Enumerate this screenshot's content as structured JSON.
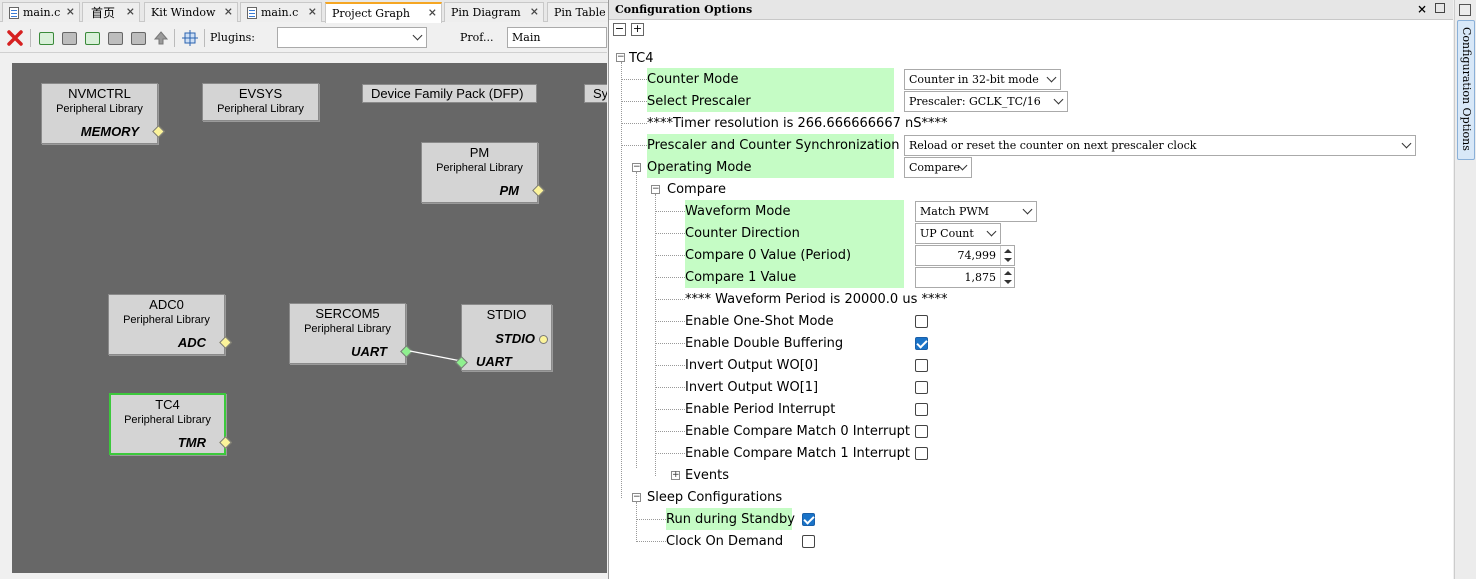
{
  "tabs": [
    {
      "label": "main.c",
      "icon": "c-file-icon",
      "active": false
    },
    {
      "label": "首页",
      "icon": "",
      "active": false
    },
    {
      "label": "Kit Window",
      "icon": "",
      "active": false
    },
    {
      "label": "main.c",
      "icon": "c-file-icon",
      "active": false
    },
    {
      "label": "Project Graph",
      "icon": "",
      "active": true
    },
    {
      "label": "Pin Diagram",
      "icon": "",
      "active": false
    },
    {
      "label": "Pin Table",
      "icon": "",
      "active": false
    }
  ],
  "toolbar": {
    "plugins_label": "Plugins:",
    "plugins_value": "",
    "prof_label": "Prof...",
    "prof_value": "Main"
  },
  "graph": {
    "nvmctrl": {
      "title": "NVMCTRL",
      "sub": "Peripheral Library",
      "port": "MEMORY"
    },
    "evsys": {
      "title": "EVSYS",
      "sub": "Peripheral Library"
    },
    "dfp": {
      "title": "Device Family Pack (DFP)"
    },
    "sy": {
      "title": "Sy"
    },
    "pm": {
      "title": "PM",
      "sub": "Peripheral Library",
      "port": "PM"
    },
    "adc0": {
      "title": "ADC0",
      "sub": "Peripheral Library",
      "port": "ADC"
    },
    "sercom5": {
      "title": "SERCOM5",
      "sub": "Peripheral Library",
      "port": "UART"
    },
    "stdio": {
      "title": "STDIO",
      "port_top": "STDIO",
      "port_bottom": "UART"
    },
    "tc4": {
      "title": "TC4",
      "sub": "Peripheral Library",
      "port": "TMR"
    }
  },
  "config": {
    "title": "Configuration Options",
    "side_tab": "Configuration Options",
    "root": "TC4",
    "counter_mode": {
      "label": "Counter Mode",
      "value": "Counter in 32-bit mode"
    },
    "prescaler": {
      "label": "Select Prescaler",
      "value": "Prescaler: GCLK_TC/16"
    },
    "timer_res": "****Timer resolution is 266.666666667 nS****",
    "presync": {
      "label": "Prescaler and Counter Synchronization",
      "value": "Reload or reset the counter on next prescaler clock"
    },
    "op_mode": {
      "label": "Operating Mode",
      "value": "Compare"
    },
    "compare": "Compare",
    "waveform_mode": {
      "label": "Waveform Mode",
      "value": "Match PWM"
    },
    "counter_dir": {
      "label": "Counter Direction",
      "value": "UP Count"
    },
    "cmp0": {
      "label": "Compare 0 Value (Period)",
      "value": "74,999"
    },
    "cmp1": {
      "label": "Compare 1 Value",
      "value": "1,875"
    },
    "wave_period": "**** Waveform Period is 20000.0 us ****",
    "one_shot": {
      "label": "Enable One-Shot Mode",
      "checked": false
    },
    "double_buf": {
      "label": "Enable Double Buffering",
      "checked": true
    },
    "inv_wo0": {
      "label": "Invert Output WO[0]",
      "checked": false
    },
    "inv_wo1": {
      "label": "Invert Output WO[1]",
      "checked": false
    },
    "period_int": {
      "label": "Enable Period Interrupt",
      "checked": false
    },
    "cm0_int": {
      "label": "Enable Compare Match 0 Interrupt",
      "checked": false
    },
    "cm1_int": {
      "label": "Enable Compare Match 1 Interrupt",
      "checked": false
    },
    "events": "Events",
    "sleep": "Sleep Configurations",
    "run_standby": {
      "label": "Run during Standby",
      "checked": true
    },
    "clock_demand": {
      "label": "Clock On Demand",
      "checked": false
    }
  }
}
